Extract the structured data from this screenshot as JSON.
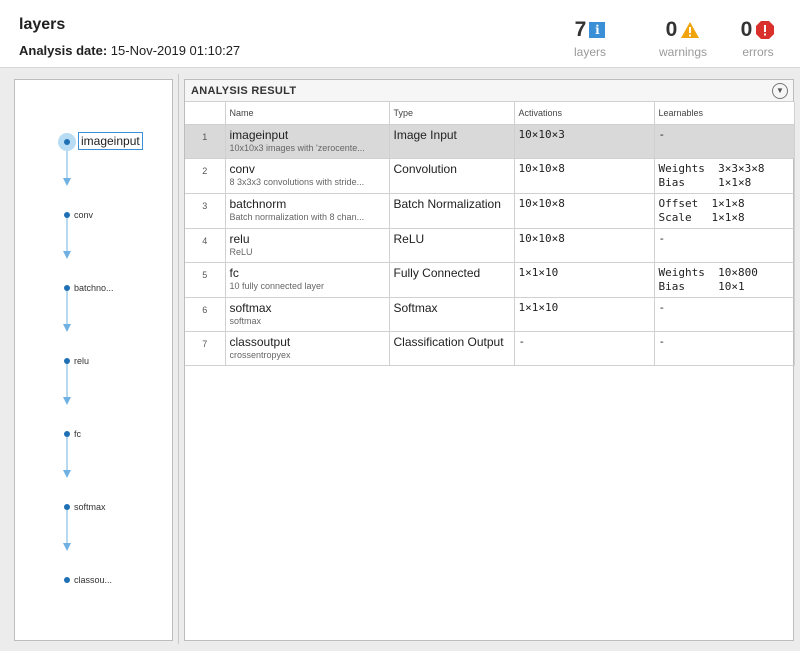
{
  "header": {
    "title": "layers",
    "date_label": "Analysis date:",
    "date_value": "15-Nov-2019 01:10:27",
    "stats": [
      {
        "count": "7",
        "caption": "layers",
        "icon": "info-icon",
        "color": "#3b8fd6"
      },
      {
        "count": "0",
        "caption": "warnings",
        "icon": "warning-icon",
        "color": "#f0a30a"
      },
      {
        "count": "0",
        "caption": "errors",
        "icon": "error-icon",
        "color": "#d9302c"
      }
    ]
  },
  "graph": {
    "nodes": [
      {
        "label": "imageinput"
      },
      {
        "label": "conv"
      },
      {
        "label": "batchno..."
      },
      {
        "label": "relu"
      },
      {
        "label": "fc"
      },
      {
        "label": "softmax"
      },
      {
        "label": "classou..."
      }
    ]
  },
  "result": {
    "title": "ANALYSIS RESULT",
    "columns": [
      "Name",
      "Type",
      "Activations",
      "Learnables"
    ],
    "rows": [
      {
        "index": "1",
        "name": "imageinput",
        "desc": "10x10x3 images with 'zerocente...",
        "type": "Image Input",
        "activations": "10×10×3",
        "learnables": [
          "-"
        ]
      },
      {
        "index": "2",
        "name": "conv",
        "desc": "8 3x3x3 convolutions with stride...",
        "type": "Convolution",
        "activations": "10×10×8",
        "learnables": [
          "Weights  3×3×3×8",
          "Bias     1×1×8"
        ]
      },
      {
        "index": "3",
        "name": "batchnorm",
        "desc": "Batch normalization with 8 chan...",
        "type": "Batch Normalization",
        "activations": "10×10×8",
        "learnables": [
          "Offset  1×1×8",
          "Scale   1×1×8"
        ]
      },
      {
        "index": "4",
        "name": "relu",
        "desc": "ReLU",
        "type": "ReLU",
        "activations": "10×10×8",
        "learnables": [
          "-"
        ]
      },
      {
        "index": "5",
        "name": "fc",
        "desc": "10 fully connected layer",
        "type": "Fully Connected",
        "activations": "1×1×10",
        "learnables": [
          "Weights  10×800",
          "Bias     10×1"
        ]
      },
      {
        "index": "6",
        "name": "softmax",
        "desc": "softmax",
        "type": "Softmax",
        "activations": "1×1×10",
        "learnables": [
          "-"
        ]
      },
      {
        "index": "7",
        "name": "classoutput",
        "desc": "crossentropyex",
        "type": "Classification Output",
        "activations": "-",
        "learnables": [
          "-"
        ]
      }
    ]
  }
}
